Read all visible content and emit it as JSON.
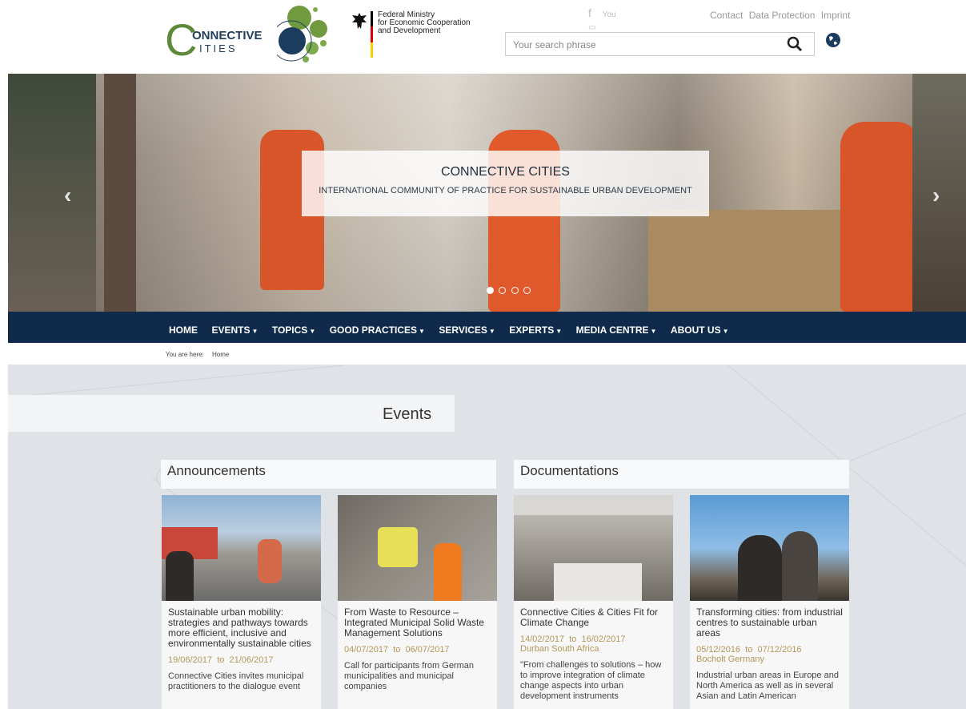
{
  "header": {
    "logo": {
      "big_letter": "C",
      "word_top": "ONNECTIVE",
      "word_bottom": "ITIES"
    },
    "ministry": {
      "line1": "Federal Ministry",
      "line2": "for Economic Cooperation",
      "line3": "and Development"
    },
    "social": [
      "facebook-icon",
      "youtube-icon"
    ],
    "links": [
      "Contact",
      "Data Protection",
      "Imprint"
    ],
    "search_placeholder": "Your search phrase"
  },
  "hero": {
    "title": "CONNECTIVE CITIES",
    "subtitle": "INTERNATIONAL COMMUNITY OF PRACTICE FOR SUSTAINABLE URBAN DEVELOPMENT",
    "slide_count": 4,
    "active_slide": 1
  },
  "nav": {
    "items": [
      {
        "label": "HOME",
        "dropdown": false
      },
      {
        "label": "EVENTS",
        "dropdown": true
      },
      {
        "label": "TOPICS",
        "dropdown": true
      },
      {
        "label": "GOOD PRACTICES",
        "dropdown": true
      },
      {
        "label": "SERVICES",
        "dropdown": true
      },
      {
        "label": "EXPERTS",
        "dropdown": true
      },
      {
        "label": "MEDIA CENTRE",
        "dropdown": true
      },
      {
        "label": "ABOUT US",
        "dropdown": true
      }
    ]
  },
  "breadcrumb": {
    "prefix": "You are here:",
    "current": "Home"
  },
  "content": {
    "title": "Events",
    "announcements": {
      "title": "Announcements",
      "cards": [
        {
          "title": "Sustainable urban mobility: strategies and pathways towards more efficient, inclusive and environmentally sustainable cities",
          "date_from": "19/06/2017",
          "date_sep": "to",
          "date_to": "21/06/2017",
          "location": "",
          "desc": "Connective Cities invites municipal practitioners to the dialogue event"
        },
        {
          "title": "From Waste to Resource – Integrated Municipal Solid Waste Management Solutions",
          "date_from": "04/07/2017",
          "date_sep": "to",
          "date_to": "06/07/2017",
          "location": "",
          "desc": "Call for participants from German municipalities and municipal companies"
        }
      ]
    },
    "documentations": {
      "title": "Documentations",
      "cards": [
        {
          "title": "Connective Cities & Cities Fit for Climate Change",
          "date_from": "14/02/2017",
          "date_sep": "to",
          "date_to": "16/02/2017",
          "location": "Durban South Africa",
          "desc": "\"From challenges to solutions – how to improve integration of climate change aspects into urban development instruments"
        },
        {
          "title": "Transforming cities: from industrial centres to sustainable urban areas",
          "date_from": "05/12/2016",
          "date_sep": "to",
          "date_to": "07/12/2016",
          "location": "Bocholt Germany",
          "desc": "Industrial urban areas in Europe and North America as well as in several Asian and Latin American"
        }
      ]
    }
  }
}
